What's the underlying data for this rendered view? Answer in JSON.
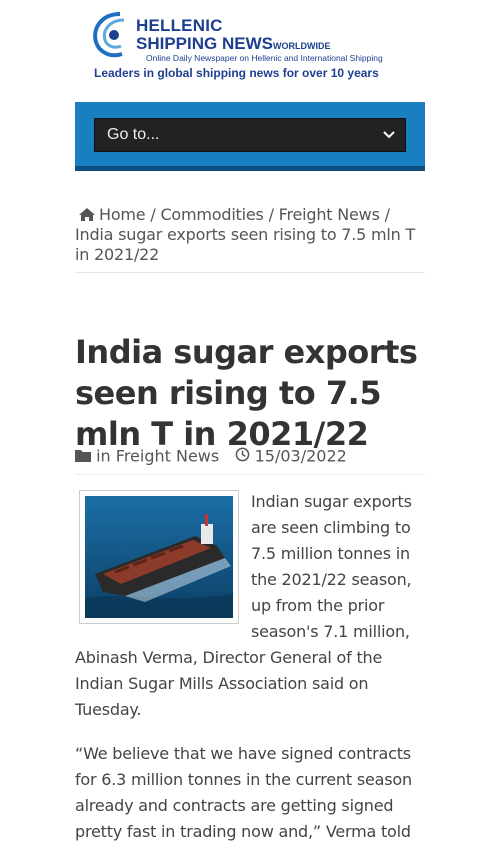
{
  "header": {
    "brand_line1": "HELLENIC",
    "brand_line2": "SHIPPING NEWS",
    "brand_suffix": "WORLDWIDE",
    "tagline_small": "Online Daily Newspaper on Hellenic and International Shipping",
    "tagline_big": "Leaders in global shipping news for over 10 years",
    "brand_color": "#1e3f8f"
  },
  "nav": {
    "select_value": "Go to...",
    "bar_color": "#1a7fc0"
  },
  "breadcrumb": {
    "home": "Home",
    "sep": "/",
    "item1": "Commodities",
    "item2": "Freight News",
    "current": "India sugar exports seen rising to 7.5 mln T in 2021/22"
  },
  "article": {
    "title": "India sugar exports seen rising to 7.5 mln T in 2021/22",
    "category_prefix": "in",
    "category": "Freight News",
    "date": "15/03/2022",
    "paragraph1": "Indian sugar exports are seen climbing to 7.5 million tonnes in the 2021/22 season, up from the prior season's 7.1 million, Abinash Verma, Director General of the Indian Sugar Mills Association said on Tuesday.",
    "paragraph2": "“We believe that we have signed contracts for 6.3 million tonnes in the current season already and contracts are getting signed pretty fast in trading now and,” Verma told"
  }
}
